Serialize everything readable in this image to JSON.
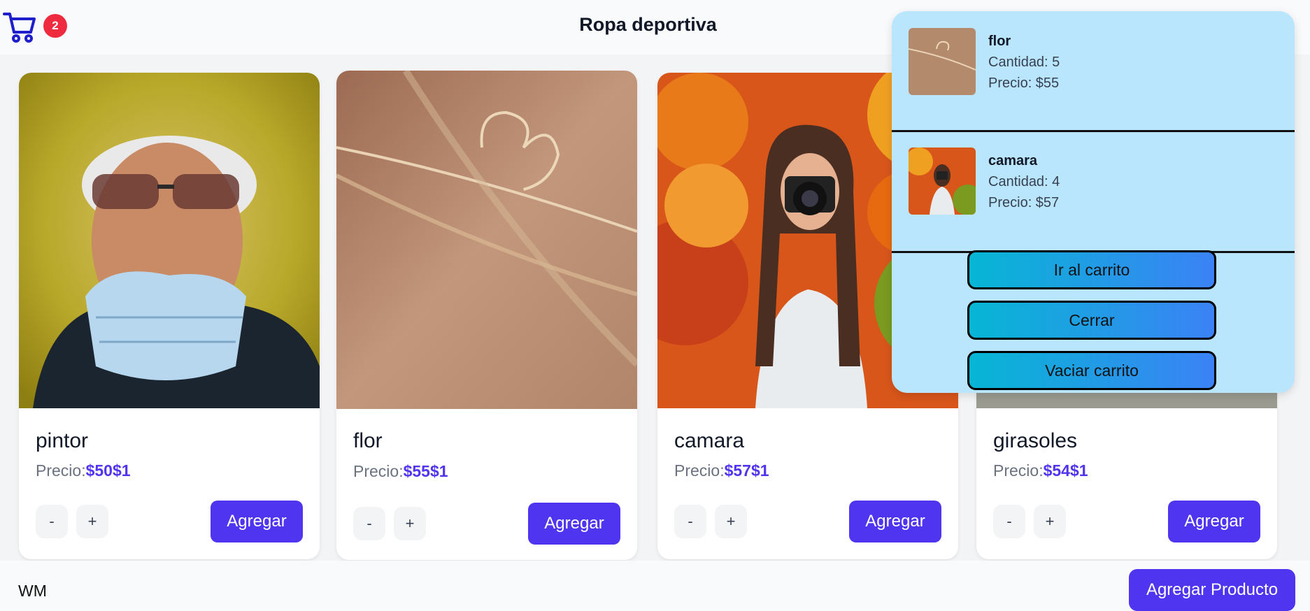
{
  "header": {
    "title": "Ropa deportiva",
    "cart_count": "2",
    "cart_icon": "shopping-cart-icon",
    "cart_color": "#1e1ecc",
    "badge_color": "#ef2b3f"
  },
  "products": [
    {
      "name": "pintor",
      "price_label": "Precio:",
      "price_value": "$50$1",
      "minus": "-",
      "plus": "+",
      "add_label": "Agregar",
      "image": "elderly-man-with-sunglasses-and-mask"
    },
    {
      "name": "flor",
      "price_label": "Precio:",
      "price_value": "$55$1",
      "minus": "-",
      "plus": "+",
      "add_label": "Agregar",
      "image": "dried-grass-heart"
    },
    {
      "name": "camara",
      "price_label": "Precio:",
      "price_value": "$57$1",
      "minus": "-",
      "plus": "+",
      "add_label": "Agregar",
      "image": "woman-with-camera-autumn-trees"
    },
    {
      "name": "girasoles",
      "price_label": "Precio:",
      "price_value": "$54$1",
      "minus": "-",
      "plus": "+",
      "add_label": "Agregar",
      "image": "sunflowers"
    }
  ],
  "cart_panel": {
    "items": [
      {
        "name": "flor",
        "quantity": "Cantidad: 5",
        "price": "Precio: $55"
      },
      {
        "name": "camara",
        "quantity": "Cantidad: 4",
        "price": "Precio: $57"
      }
    ],
    "go_to_cart": "Ir al carrito",
    "close": "Cerrar",
    "empty_cart": "Vaciar carrito"
  },
  "footer": {
    "text": "WM",
    "add_product": "Agregar Producto"
  },
  "colors": {
    "accent": "#4f35ef",
    "panel_bg": "#bae6fd"
  }
}
